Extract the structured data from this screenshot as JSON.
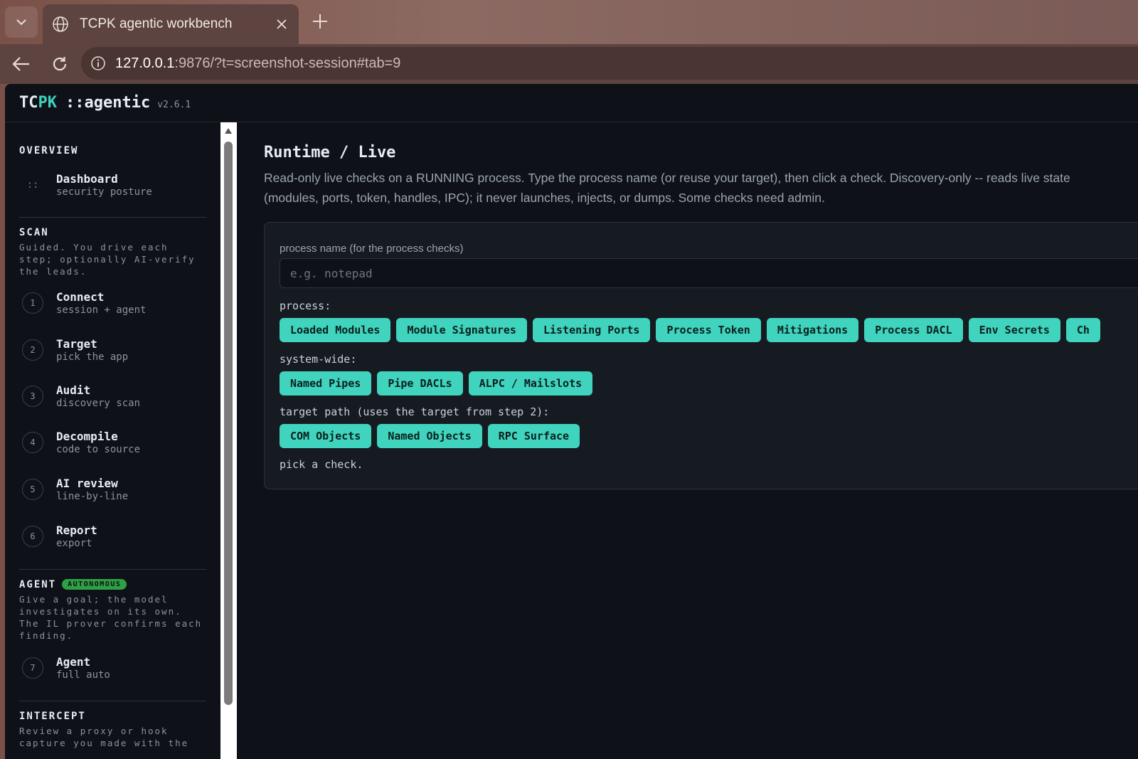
{
  "browser": {
    "tab_title": "TCPK agentic workbench",
    "url_host": "127.0.0.1",
    "url_rest": ":9876/?t=screenshot-session#tab=9"
  },
  "app": {
    "logo_tc": "TC",
    "logo_pk": "PK",
    "logo_rest": "::agentic",
    "version": "v2.6.1"
  },
  "sidebar": {
    "overview": {
      "title": "OVERVIEW",
      "items": [
        {
          "icon": "::",
          "label": "Dashboard",
          "sub": "security posture"
        }
      ]
    },
    "scan": {
      "title": "SCAN",
      "desc": "Guided. You drive each step; optionally AI-verify the leads.",
      "items": [
        {
          "num": "1",
          "label": "Connect",
          "sub": "session + agent"
        },
        {
          "num": "2",
          "label": "Target",
          "sub": "pick the app"
        },
        {
          "num": "3",
          "label": "Audit",
          "sub": "discovery scan"
        },
        {
          "num": "4",
          "label": "Decompile",
          "sub": "code to source"
        },
        {
          "num": "5",
          "label": "AI review",
          "sub": "line-by-line"
        },
        {
          "num": "6",
          "label": "Report",
          "sub": "export"
        }
      ]
    },
    "agent": {
      "title": "AGENT",
      "badge": "AUTONOMOUS",
      "desc": "Give a goal; the model investigates on its own. The IL prover confirms each finding.",
      "items": [
        {
          "num": "7",
          "label": "Agent",
          "sub": "full auto"
        }
      ]
    },
    "intercept": {
      "title": "INTERCEPT",
      "desc": "Review a proxy or hook capture you made with the"
    }
  },
  "main": {
    "title": "Runtime / Live",
    "description": "Read-only live checks on a RUNNING process. Type the process name (or reuse your target), then click a check. Discovery-only -- reads live state (modules, ports, token, handles, IPC); it never launches, injects, or dumps. Some checks need admin.",
    "process_label": "process name (for the process checks)",
    "process_placeholder": "e.g. notepad",
    "process_value": "",
    "groups": {
      "process": {
        "label": "process:",
        "buttons": [
          "Loaded Modules",
          "Module Signatures",
          "Listening Ports",
          "Process Token",
          "Mitigations",
          "Process DACL",
          "Env Secrets",
          "Ch"
        ]
      },
      "system": {
        "label": "system-wide:",
        "buttons": [
          "Named Pipes",
          "Pipe DACLs",
          "ALPC / Mailslots"
        ]
      },
      "target": {
        "label": "target path (uses the target from step 2):",
        "buttons": [
          "COM Objects",
          "Named Objects",
          "RPC Surface"
        ]
      }
    },
    "status": "pick a check."
  }
}
